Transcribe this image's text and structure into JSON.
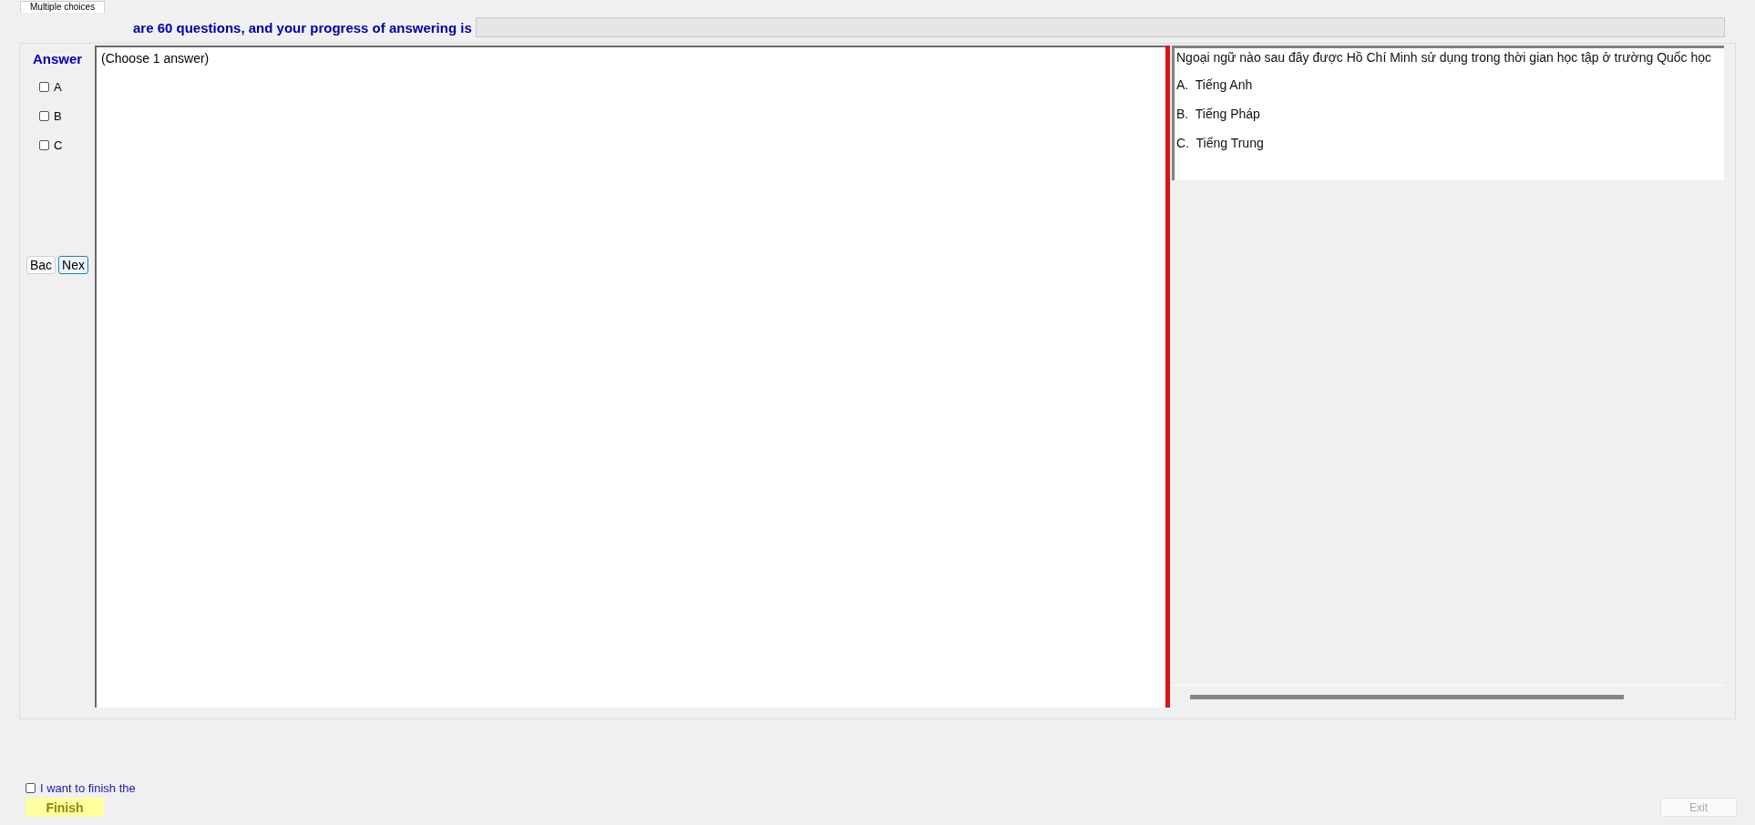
{
  "tabs": [
    {
      "label": "Multiple choices",
      "selected": true
    }
  ],
  "header": {
    "text": "are 60 questions, and your progress of answering is",
    "progress": {
      "level": 0
    }
  },
  "answer_panel": {
    "title": "Answer",
    "options": [
      {
        "label": "A",
        "checked": false
      },
      {
        "label": "B",
        "checked": false
      },
      {
        "label": "C",
        "checked": false
      }
    ],
    "nav_buttons": [
      {
        "label": "Bac",
        "focused": false
      },
      {
        "label": "Nex",
        "focused": true
      }
    ]
  },
  "instruction": "(Choose 1 answer)",
  "question": {
    "text": "Ngoại ngữ nào sau đây được Hồ Chí Minh sử dụng trong thời gian học tập ở trường Quốc học",
    "choices": [
      "A.  Tiếng Anh",
      "B.  Tiếng Pháp",
      "C.  Tiếng Trung"
    ]
  },
  "footer": {
    "finish_check": {
      "label": "I want to finish the",
      "checked": false
    },
    "finish_button": "Finish",
    "exit_button": {
      "label": "Exit",
      "disabled": true
    }
  }
}
